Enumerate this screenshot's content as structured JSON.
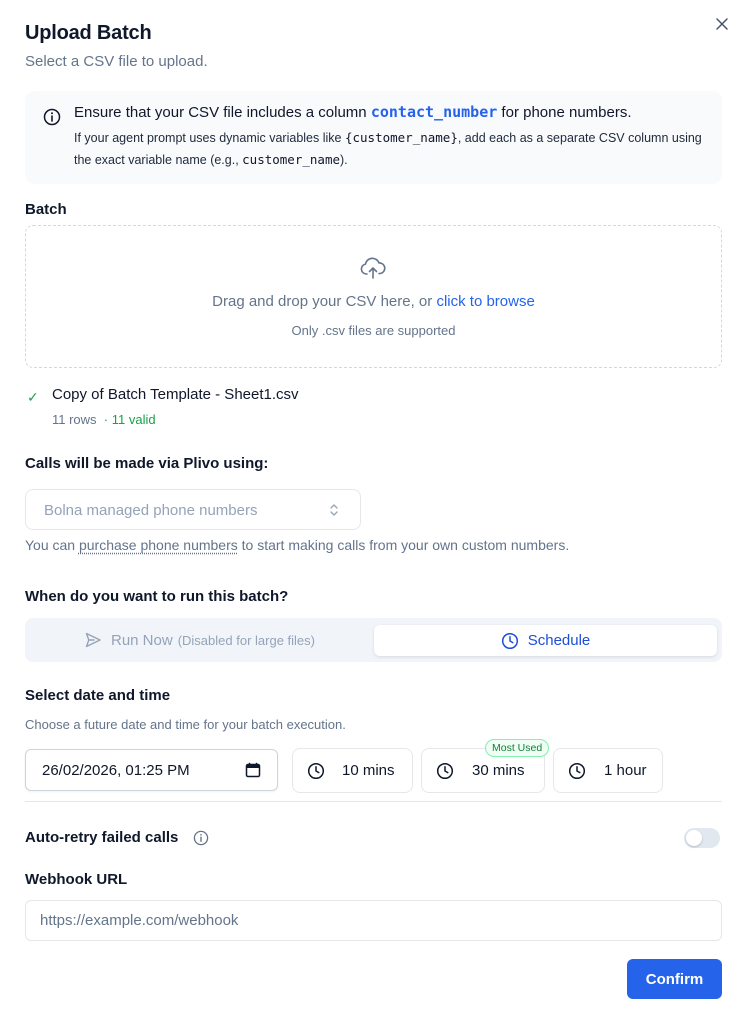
{
  "header": {
    "title": "Upload Batch",
    "subtitle": "Select a CSV file to upload."
  },
  "info": {
    "line1_prefix": "Ensure that your CSV file includes a column ",
    "line1_code": "contact_number",
    "line1_suffix": " for phone numbers.",
    "line2_prefix": "If your agent prompt uses dynamic variables like ",
    "line2_code1": "{customer_name}",
    "line2_middle": ", add each as a separate CSV column using the exact variable name (e.g., ",
    "line2_code2": "customer_name",
    "line2_suffix": ")."
  },
  "batch": {
    "label": "Batch",
    "dropzone_text": "Drag and drop your CSV here, or ",
    "dropzone_link": "click to browse",
    "dropzone_hint": "Only .csv files are supported"
  },
  "file": {
    "check": "✓",
    "name": "Copy of Batch Template - Sheet1.csv",
    "rows": "11 rows",
    "valid": "· 11 valid"
  },
  "calls": {
    "label": "Calls will be made via Plivo using:",
    "select_value": "Bolna managed phone numbers",
    "note_prefix": "You can ",
    "note_link": "purchase phone numbers",
    "note_suffix": " to start making calls from your own custom numbers."
  },
  "run": {
    "label": "When do you want to run this batch?",
    "run_now": "Run Now",
    "run_now_note": "(Disabled for large files)",
    "schedule": "Schedule"
  },
  "schedule": {
    "label": "Select date and time",
    "note": "Choose a future date and time for your batch execution.",
    "date_value": "26/02/2026, 01:25 PM",
    "quick_options": [
      "10 mins",
      "30 mins",
      "1 hour"
    ],
    "badge": "Most Used"
  },
  "retry": {
    "label": "Auto-retry failed calls",
    "enabled": false
  },
  "webhook": {
    "label": "Webhook URL",
    "placeholder": "https://example.com/webhook"
  },
  "footer": {
    "confirm": "Confirm"
  },
  "colors": {
    "accent": "#2563eb",
    "success": "#16a34a",
    "muted": "#64748b"
  }
}
